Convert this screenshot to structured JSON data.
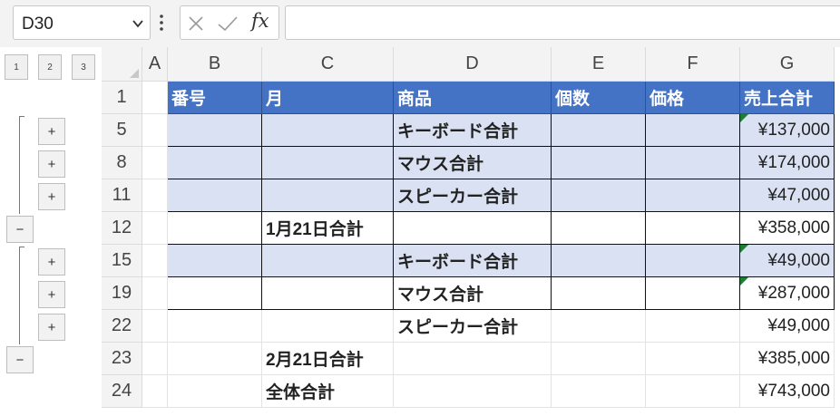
{
  "formula_bar": {
    "name_box": "D30",
    "fx_label": "fx",
    "formula": ""
  },
  "outline": {
    "levels": [
      "1",
      "2",
      "3"
    ],
    "expand_symbol": "+",
    "collapse_symbol": "−"
  },
  "columns": [
    "A",
    "B",
    "C",
    "D",
    "E",
    "F",
    "G"
  ],
  "rows": [
    {
      "num": "1",
      "B": "番号",
      "C": "月",
      "D": "商品",
      "E": "個数",
      "F": "価格",
      "G": "売上合計"
    },
    {
      "num": "5",
      "B": "",
      "C": "",
      "D": "キーボード合計",
      "E": "",
      "F": "",
      "G": "¥137,000"
    },
    {
      "num": "8",
      "B": "",
      "C": "",
      "D": "マウス合計",
      "E": "",
      "F": "",
      "G": "¥174,000"
    },
    {
      "num": "11",
      "B": "",
      "C": "",
      "D": "スピーカー合計",
      "E": "",
      "F": "",
      "G": "¥47,000"
    },
    {
      "num": "12",
      "B": "",
      "C": "1月21日合計",
      "D": "",
      "E": "",
      "F": "",
      "G": "¥358,000"
    },
    {
      "num": "15",
      "B": "",
      "C": "",
      "D": "キーボード合計",
      "E": "",
      "F": "",
      "G": "¥49,000"
    },
    {
      "num": "19",
      "B": "",
      "C": "",
      "D": "マウス合計",
      "E": "",
      "F": "",
      "G": "¥287,000"
    },
    {
      "num": "22",
      "B": "",
      "C": "",
      "D": "スピーカー合計",
      "E": "",
      "F": "",
      "G": "¥49,000"
    },
    {
      "num": "23",
      "B": "",
      "C": "2月21日合計",
      "D": "",
      "E": "",
      "F": "",
      "G": "¥385,000"
    },
    {
      "num": "24",
      "B": "",
      "C": "全体合計",
      "D": "",
      "E": "",
      "F": "",
      "G": "¥743,000"
    }
  ],
  "colors": {
    "header_fill": "#4472c4",
    "band_fill": "#d9e1f2",
    "error_indicator": "#1e7e34"
  }
}
